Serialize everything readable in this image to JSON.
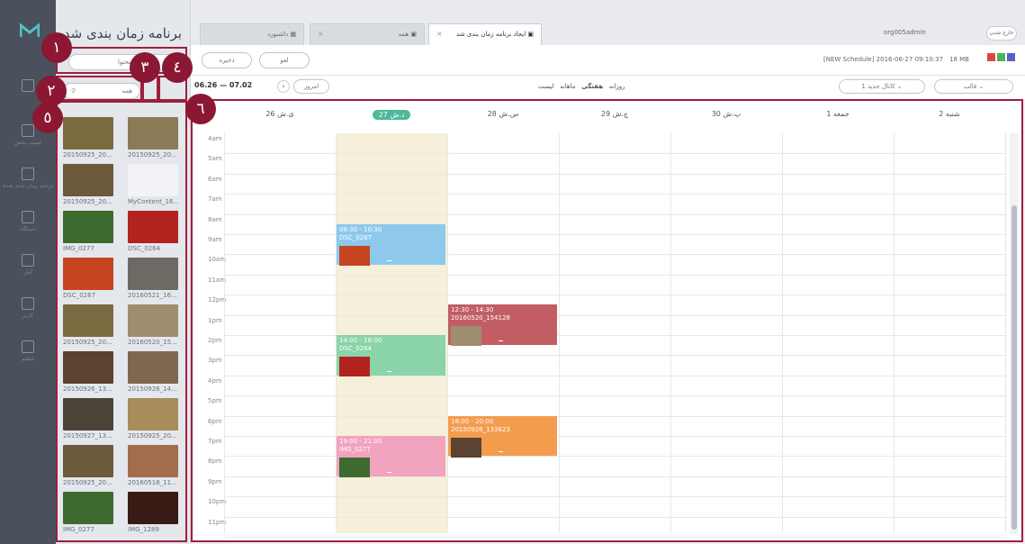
{
  "sidebar": {
    "title": "برنامه زمان بندی شده",
    "content_label": "محتوا",
    "search_label": "همه",
    "items": [
      {
        "name": "20150925_20...",
        "color": "#7a6a3f"
      },
      {
        "name": "20150925_20...",
        "color": "#8b7a58"
      },
      {
        "name": "20150925_20...",
        "color": "#6d5a3a"
      },
      {
        "name": "MyContent_16...",
        "color": "#f3f3f7"
      },
      {
        "name": "IMG_0277",
        "color": "#3d6b2f"
      },
      {
        "name": "DSC_0264",
        "color": "#b2231f"
      },
      {
        "name": "DSC_0267",
        "color": "#c44520"
      },
      {
        "name": "20160521_16...",
        "color": "#6c6a63"
      },
      {
        "name": "20150925_20...",
        "color": "#7a6a3f"
      },
      {
        "name": "20160520_15...",
        "color": "#9e8d6f"
      },
      {
        "name": "20150926_13...",
        "color": "#5a4330"
      },
      {
        "name": "20150926_14...",
        "color": "#7d6750"
      },
      {
        "name": "20150927_13...",
        "color": "#4c4438"
      },
      {
        "name": "20150925_20...",
        "color": "#a88c5b"
      },
      {
        "name": "20150925_20...",
        "color": "#6d5a3a"
      },
      {
        "name": "20160518_11...",
        "color": "#a26d4f"
      },
      {
        "name": "IMG_0277",
        "color": "#3d6b2f"
      },
      {
        "name": "IMG_1289",
        "color": "#3a1a14"
      }
    ]
  },
  "nav": {
    "items": [
      "",
      "لیست پخش",
      "برنامه زمان بندی شده",
      "دستگاه",
      "آمار",
      "کاربر",
      "تنظیم"
    ]
  },
  "tabs": [
    {
      "label": "داشبورد"
    },
    {
      "label": "همه"
    },
    {
      "label": "ایجاد برنامه زمان بندی شد"
    }
  ],
  "header": {
    "user": "org005admin",
    "logout": "خارج شدن",
    "status": "[NEW Schedule] 2016-06-27 09:10:37",
    "size": "18 MB"
  },
  "actions": {
    "cancel": "لغو",
    "save": "ذخیره"
  },
  "toolbar": {
    "date_range": "06.26 — 07.02",
    "today": "امروز",
    "views": [
      "لیست",
      "ماهانه",
      "هفتگی",
      "روزانه"
    ],
    "channel": "کانال جدید 1",
    "template": "قالب"
  },
  "calendar": {
    "days": [
      "ی.ش 26",
      "د.ش 27",
      "س.ش 28",
      "چ.ش 29",
      "پ.ش 30",
      "جمعه 1",
      "شنبه 2"
    ],
    "hours": [
      "4am",
      "5am",
      "6am",
      "7am",
      "8am",
      "9am",
      "10am",
      "11am",
      "12pm",
      "1pm",
      "2pm",
      "3pm",
      "4pm",
      "5pm",
      "6pm",
      "7pm",
      "8pm",
      "9pm",
      "10pm",
      "11pm"
    ],
    "events": [
      {
        "time": "08:30 - 10:30",
        "name": "DSC_0267",
        "color": "#8ec9ec",
        "img": "#c44520"
      },
      {
        "time": "14:00 - 16:00",
        "name": "DSC_0264",
        "color": "#8bd3a8",
        "img": "#b2231f"
      },
      {
        "time": "19:00 - 21:00",
        "name": "IMG_0277",
        "color": "#f2a3be",
        "img": "#3d6b2f"
      },
      {
        "time": "12:30 - 14:30",
        "name": "20160520_154128",
        "color": "#c25e63",
        "img": "#9e8d6f"
      },
      {
        "time": "18:00 - 20:00",
        "name": "20150926_133623",
        "color": "#f49c4e",
        "img": "#5a4330"
      }
    ]
  },
  "callouts": [
    "١",
    "٢",
    "٣",
    "٤",
    "٥",
    "٦"
  ]
}
